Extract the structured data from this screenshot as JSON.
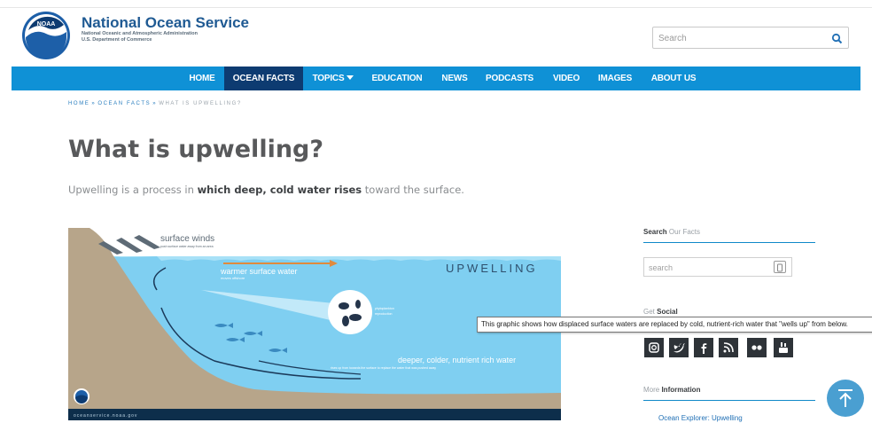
{
  "header": {
    "title": "National Ocean Service",
    "subtitle_1": "National Oceanic and Atmospheric Administration",
    "subtitle_2": "U.S. Department of Commerce",
    "logo_text": "NOAA",
    "search_placeholder": "Search"
  },
  "nav": {
    "items": [
      {
        "label": "HOME"
      },
      {
        "label": "OCEAN FACTS"
      },
      {
        "label": "TOPICS"
      },
      {
        "label": "EDUCATION"
      },
      {
        "label": "NEWS"
      },
      {
        "label": "PODCASTS"
      },
      {
        "label": "VIDEO"
      },
      {
        "label": "IMAGES"
      },
      {
        "label": "ABOUT US"
      }
    ],
    "active": "OCEAN FACTS"
  },
  "breadcrumb": {
    "home": "HOME",
    "section": "OCEAN FACTS",
    "current": "WHAT IS UPWELLING?",
    "separator": "»"
  },
  "main": {
    "title": "What is upwelling?",
    "intro_before": "Upwelling is a process in ",
    "intro_bold": "which deep, cold water rises",
    "intro_after": " toward the surface."
  },
  "graphic": {
    "title": "UPWELLING",
    "surface_winds": "surface winds",
    "surface_winds_sub": "push surface water away from an area",
    "warmer": "warmer surface water",
    "warmer_sub": "moves offshore",
    "phyto_1": "phytoplankton",
    "phyto_2": "reproduction",
    "deeper": "deeper, colder, nutrient rich water",
    "deeper_sub": "rises up from towards the surface to replace the water that was pushed away",
    "footer": "oceanservice.noaa.gov"
  },
  "sidebar": {
    "search_heading_bold": "Search",
    "search_heading_rest": " Our Facts",
    "search_placeholder": "search",
    "social_heading_pre": "Get ",
    "social_heading_bold": "Social",
    "social_icons": [
      "instagram-icon",
      "twitter-icon",
      "facebook-icon",
      "rss-icon",
      "flickr-icon",
      "youtube-icon"
    ],
    "more_pre": "More ",
    "more_bold": "Information",
    "link_1": "Ocean Explorer: Upwelling"
  },
  "tooltip": "This graphic shows how displaced surface waters are replaced by cold, nutrient-rich water that \"wells up\" from below.",
  "colors": {
    "nav_bg": "#0f91d6",
    "nav_active": "#0d3b71",
    "brand": "#1f5a93",
    "water": "#7fcff1",
    "land": "#b7a58a",
    "back_to_top": "#4a9fd1"
  }
}
